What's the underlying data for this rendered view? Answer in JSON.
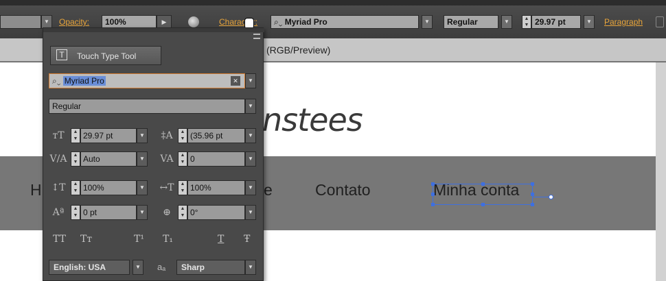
{
  "control_bar": {
    "opacity_label": "Opacity:",
    "opacity_value": "100%",
    "character_label": "Character:",
    "font_family": "Myriad Pro",
    "font_style": "Regular",
    "font_size": "29.97 pt",
    "paragraph_label": "Paragraph"
  },
  "document_tab": {
    "title": "(RGB/Preview)"
  },
  "canvas": {
    "logo_fragment": "nstees",
    "nav_items": [
      "H",
      "e",
      "Contato",
      "Minha conta"
    ]
  },
  "character_panel": {
    "touch_type_label": "Touch Type Tool",
    "font_family": "Myriad Pro",
    "font_style": "Regular",
    "font_size": "29.97 pt",
    "leading": "(35.96 pt",
    "kerning": "Auto",
    "tracking": "0",
    "vertical_scale": "100%",
    "horizontal_scale": "100%",
    "baseline_shift": "0 pt",
    "rotation": "0°",
    "caps_buttons": [
      "TT",
      "Tт",
      "T¹",
      "T₁",
      "T",
      "Ŧ"
    ],
    "language": "English: USA",
    "aa_label": "aₐ",
    "antialias": "Sharp"
  },
  "colors": {
    "accent": "#e9a53a",
    "selection": "#3e6fe0"
  }
}
